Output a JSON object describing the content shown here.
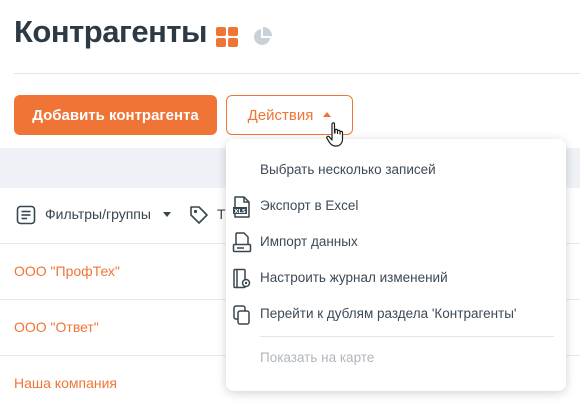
{
  "header": {
    "title": "Контрагенты",
    "icons": [
      "grid-view-icon",
      "pie-chart-icon"
    ]
  },
  "toolbar": {
    "add_label": "Добавить контрагента",
    "actions_label": "Действия"
  },
  "filters": {
    "filters_label": "Фильтры/группы",
    "tags_label": "Т"
  },
  "rows": [
    "ООО \"ПрофТех\"",
    "ООО \"Ответ\"",
    "Наша компания"
  ],
  "menu": {
    "items": [
      {
        "label": "Выбрать несколько записей",
        "icon": ""
      },
      {
        "label": "Экспорт в Excel",
        "icon": "xls-file-icon"
      },
      {
        "label": "Импорт данных",
        "icon": "import-icon"
      },
      {
        "label": "Настроить журнал изменений",
        "icon": "changelog-settings-icon"
      },
      {
        "label": "Перейти к дублям раздела 'Контрагенты'",
        "icon": "duplicates-icon"
      },
      {
        "label": "Показать на карте",
        "icon": "",
        "disabled": true
      }
    ],
    "xls_badge": "XLS"
  },
  "colors": {
    "accent": "#f07436",
    "title": "#2d3a46",
    "band": "#eef2f6",
    "muted": "#aab4bd"
  }
}
